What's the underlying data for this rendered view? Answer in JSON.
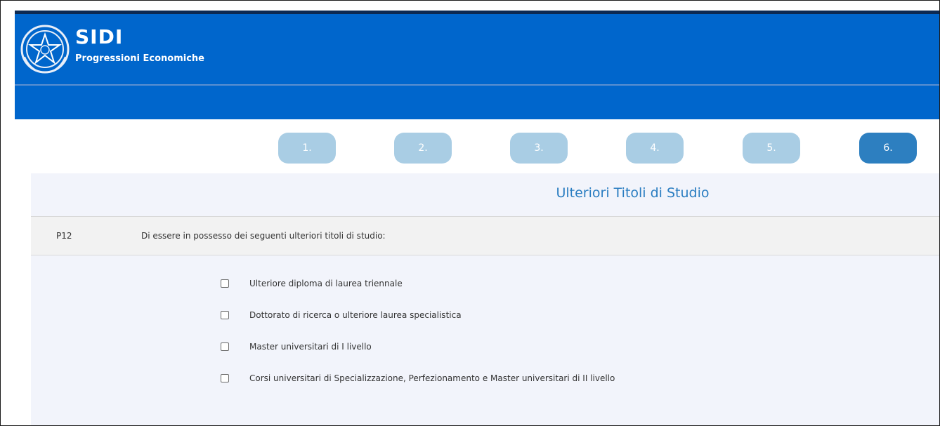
{
  "header": {
    "title": "SIDI",
    "subtitle": "Progressioni Economiche",
    "emblem_icon": "italian-republic-emblem-icon",
    "background_color": "#0066cc"
  },
  "steps": [
    {
      "label": "1.",
      "active": false
    },
    {
      "label": "2.",
      "active": false
    },
    {
      "label": "3.",
      "active": false
    },
    {
      "label": "4.",
      "active": false
    },
    {
      "label": "5.",
      "active": false
    },
    {
      "label": "6.",
      "active": true
    }
  ],
  "section": {
    "title": "Ulteriori Titoli di Studio",
    "question": {
      "code": "P12",
      "text": "Di essere in possesso dei seguenti ulteriori titoli di studio:"
    },
    "options": [
      {
        "label": "Ulteriore diploma di laurea triennale",
        "checked": false
      },
      {
        "label": "Dottorato di ricerca o ulteriore laurea specialistica",
        "checked": false
      },
      {
        "label": "Master universitari di I livello",
        "checked": false
      },
      {
        "label": "Corsi universitari di Specializzazione, Perfezionamento e Master universitari di II livello",
        "checked": false
      }
    ]
  },
  "colors": {
    "step_inactive": "#a9cde4",
    "step_active": "#2d7fc0",
    "title_accent": "#2a7dc1"
  }
}
